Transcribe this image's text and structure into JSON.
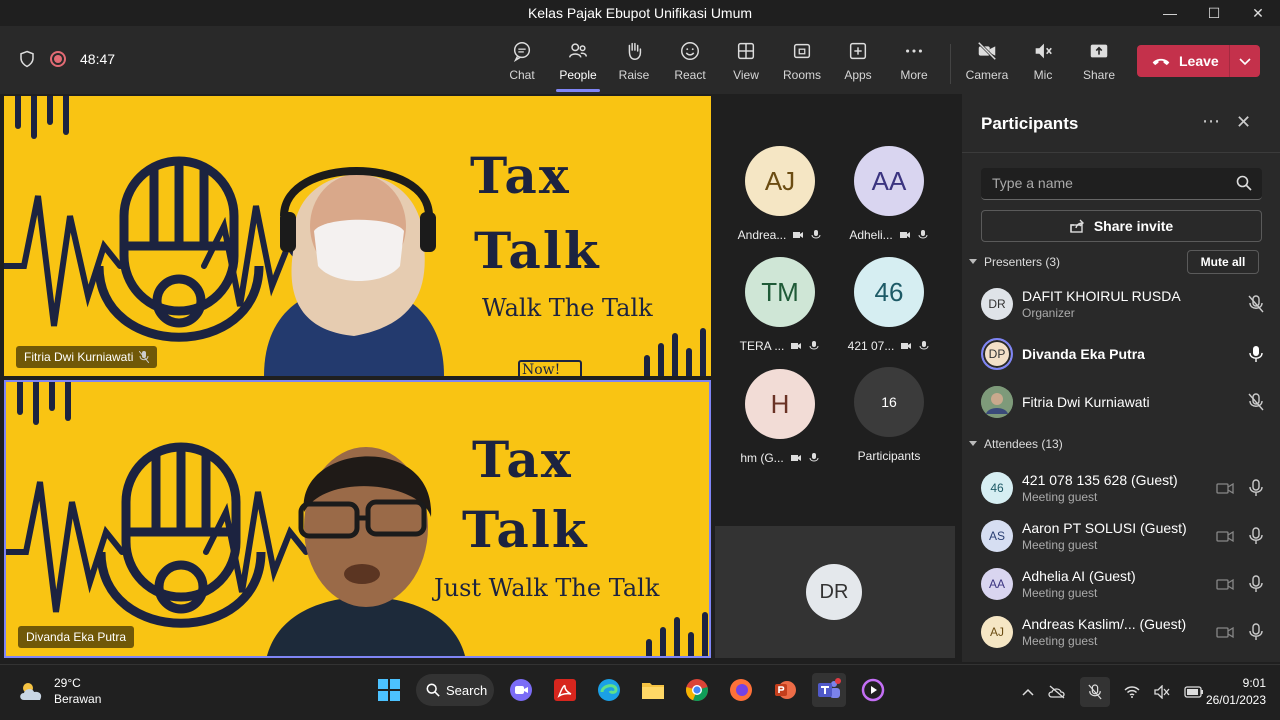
{
  "window": {
    "title": "Kelas Pajak Ebupot Unifikasi Umum",
    "controls": [
      "—",
      "☐",
      "✕"
    ]
  },
  "meeting": {
    "timer": "48:47"
  },
  "toolbar": {
    "buttons": [
      {
        "label": "Chat",
        "icon": "chat-icon"
      },
      {
        "label": "People",
        "icon": "people-icon"
      },
      {
        "label": "Raise",
        "icon": "raise-hand-icon"
      },
      {
        "label": "React",
        "icon": "react-icon"
      },
      {
        "label": "View",
        "icon": "view-icon"
      },
      {
        "label": "Rooms",
        "icon": "rooms-icon"
      },
      {
        "label": "Apps",
        "icon": "apps-icon"
      },
      {
        "label": "More",
        "icon": "more-icon"
      },
      {
        "label": "Camera",
        "icon": "camera-off-icon"
      },
      {
        "label": "Mic",
        "icon": "mic-off-icon"
      },
      {
        "label": "Share",
        "icon": "share-icon"
      }
    ],
    "leave_label": "Leave",
    "accent": "#7f85f5",
    "leave_color": "#c4314b"
  },
  "videos": [
    {
      "name": "Fitria Dwi Kurniawati",
      "poster_title_1": "Tax",
      "poster_title_2": "Talk",
      "poster_sub": "Walk The Talk",
      "poster_bottom": "Now!"
    },
    {
      "name": "Divanda Eka Putra",
      "poster_title_1": "Tax",
      "poster_title_2": "Talk",
      "poster_sub": "Just Walk The Talk"
    }
  ],
  "grid": {
    "tiles": [
      {
        "initials": "AJ",
        "label": "Andrea...",
        "color": "#f5e6c4"
      },
      {
        "initials": "AA",
        "label": "Adheli...",
        "color": "#d9d5f0"
      },
      {
        "initials": "TM",
        "label": "TERA ...",
        "color": "#cfe6d6"
      },
      {
        "initials": "46",
        "label": "421 07...",
        "color": "#d6eef2"
      },
      {
        "initials": "H",
        "label": "hm (G...",
        "color": "#f2dcd6"
      }
    ],
    "overflow_count": "16",
    "overflow_label": "Participants",
    "self_initials": "DR"
  },
  "panel": {
    "title": "Participants",
    "search_placeholder": "Type a name",
    "share_invite": "Share invite",
    "presenters_header": "Presenters (3)",
    "mute_all": "Mute all",
    "attendees_header": "Attendees (13)",
    "presenters": [
      {
        "initials": "DR",
        "name": "DAFIT KHOIRUL RUSDA",
        "role": "Organizer",
        "color": "#dfe3e8"
      },
      {
        "initials": "DP",
        "name": "Divanda Eka Putra",
        "role": "",
        "color": "#f3e0c8"
      },
      {
        "initials": "",
        "name": "Fitria Dwi Kurniawati",
        "role": "",
        "color": "#6b8f6b"
      }
    ],
    "attendees": [
      {
        "initials": "46",
        "name": "421 078 135 628 (Guest)",
        "role": "Meeting guest",
        "color": "#d6eef2"
      },
      {
        "initials": "AS",
        "name": "Aaron PT SOLUSI (Guest)",
        "role": "Meeting guest",
        "color": "#d6def2"
      },
      {
        "initials": "AA",
        "name": "Adhelia AI (Guest)",
        "role": "Meeting guest",
        "color": "#d9d5f0"
      },
      {
        "initials": "AJ",
        "name": "Andreas Kaslim/...  (Guest)",
        "role": "Meeting guest",
        "color": "#f5e6c4"
      }
    ]
  },
  "taskbar": {
    "temperature": "29°C",
    "weather": "Berawan",
    "search_label": "Search",
    "time": "9:01",
    "date": "26/01/2023"
  }
}
